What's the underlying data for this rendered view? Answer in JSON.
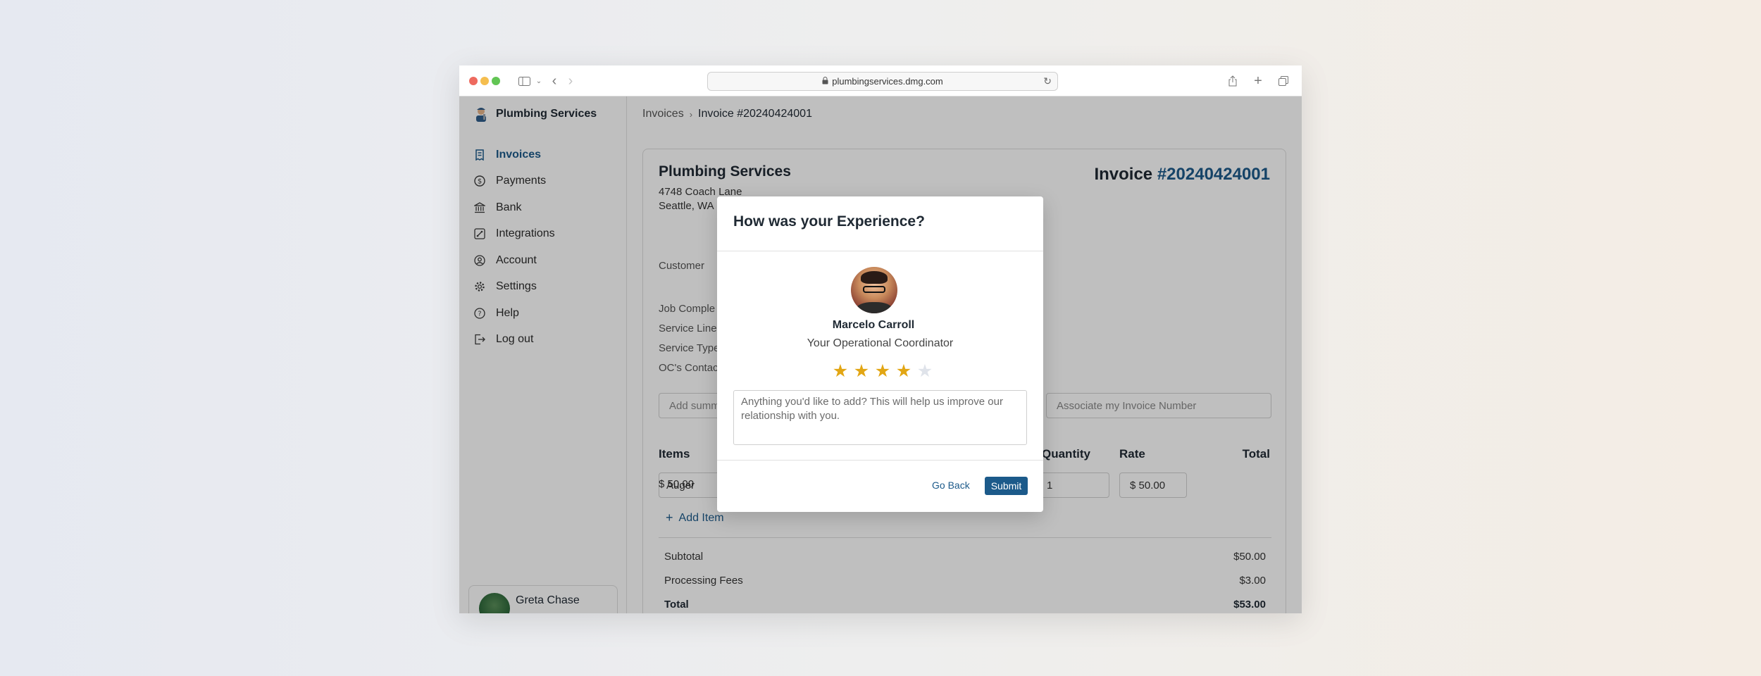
{
  "browser": {
    "url": "plumbingservices.dmg.com"
  },
  "sidebar": {
    "brand": "Plumbing Services",
    "items": [
      {
        "label": "Invoices",
        "icon": "invoice-icon",
        "active": true
      },
      {
        "label": "Payments",
        "icon": "dollar-icon",
        "active": false
      },
      {
        "label": "Bank",
        "icon": "bank-icon",
        "active": false
      },
      {
        "label": "Integrations",
        "icon": "integrations-icon",
        "active": false
      },
      {
        "label": "Account",
        "icon": "account-icon",
        "active": false
      },
      {
        "label": "Settings",
        "icon": "gear-icon",
        "active": false
      },
      {
        "label": "Help",
        "icon": "help-icon",
        "active": false
      },
      {
        "label": "Log out",
        "icon": "logout-icon",
        "active": false
      }
    ],
    "user": {
      "name": "Greta Chase"
    }
  },
  "breadcrumb": {
    "parent": "Invoices",
    "current": "Invoice #20240424001"
  },
  "invoice": {
    "company": "Plumbing Services",
    "address_line1": "4748 Coach Lane",
    "address_line2": "Seattle, WA",
    "title_prefix": "Invoice",
    "number": "#20240424001",
    "customer_label": "Customer",
    "detail_labels": [
      "Job Comple",
      "Service Line",
      "Service Type",
      "OC's Contac"
    ],
    "summary_placeholder": "Add summ",
    "associate_placeholder": "Associate my Invoice Number",
    "columns": {
      "items": "Items",
      "quantity": "Quantity",
      "rate": "Rate",
      "total": "Total"
    },
    "line_item": {
      "name": "Auger",
      "quantity": "1",
      "rate": "$ 50.00",
      "total": "$ 50.00"
    },
    "add_item": "Add Item",
    "subtotal_label": "Subtotal",
    "subtotal": "$50.00",
    "fees_label": "Processing Fees",
    "fees": "$3.00",
    "total_label": "Total",
    "total": "$53.00"
  },
  "modal": {
    "title": "How was your Experience?",
    "coordinator_name": "Marcelo Carroll",
    "coordinator_role": "Your Operational Coordinator",
    "rating": 4,
    "rating_max": 5,
    "feedback_placeholder": "Anything you'd like to add? This will help us improve our relationship with you.",
    "back_label": "Go Back",
    "submit_label": "Submit"
  },
  "colors": {
    "accent": "#1c5a8a",
    "star": "#e2a614"
  }
}
